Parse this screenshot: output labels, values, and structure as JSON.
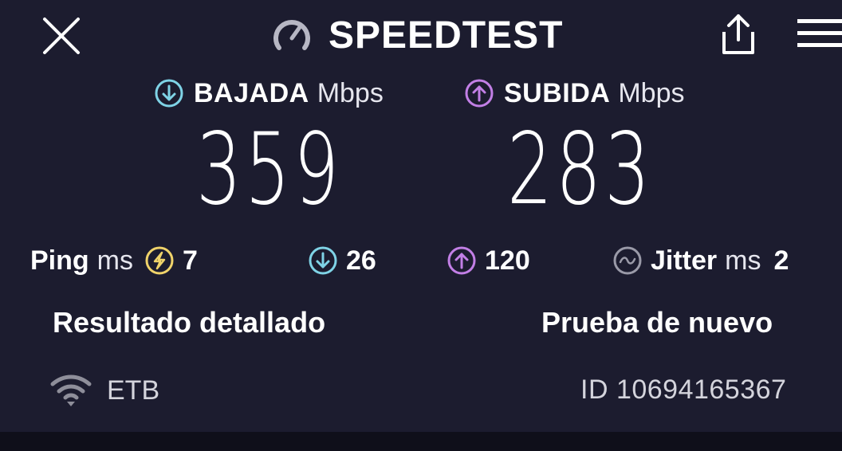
{
  "header": {
    "title": "SPEEDTEST",
    "close_icon": "close-icon",
    "logo_icon": "gauge-icon",
    "share_icon": "share-icon",
    "menu_icon": "menu-icon"
  },
  "download": {
    "label": "BAJADA",
    "unit": "Mbps",
    "value": "359",
    "icon": "arrow-down-circle-icon",
    "color": "#7fd3e6"
  },
  "upload": {
    "label": "SUBIDA",
    "unit": "Mbps",
    "value": "283",
    "icon": "arrow-up-circle-icon",
    "color": "#c27fe6"
  },
  "ping": {
    "label": "Ping",
    "unit": "ms",
    "idle_value": "7",
    "idle_icon": "ping-idle-icon",
    "idle_color": "#f0d36a",
    "download_value": "26",
    "upload_value": "120"
  },
  "jitter": {
    "label": "Jitter",
    "unit": "ms",
    "value": "2",
    "icon": "jitter-wave-icon",
    "color": "#9a9aa8"
  },
  "actions": {
    "details_label": "Resultado detallado",
    "retry_label": "Prueba de nuevo"
  },
  "footer": {
    "provider": "ETB",
    "provider_icon": "wifi-icon",
    "result_id": "ID 10694165367"
  }
}
